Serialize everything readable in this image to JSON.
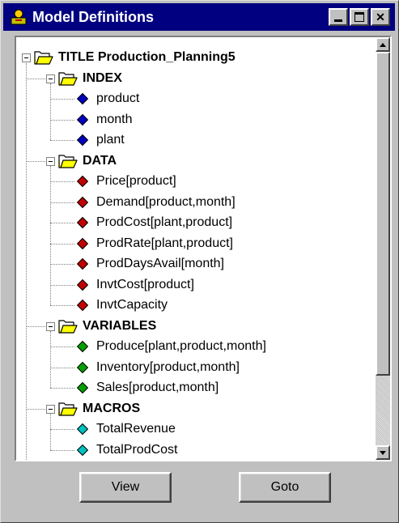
{
  "window": {
    "title": "Model Definitions",
    "close_glyph": "✕"
  },
  "colors": {
    "index": "#0000c0",
    "data": "#c00000",
    "variables": "#00a000",
    "macros": "#00c0c0",
    "folder": "#ffff00"
  },
  "tree": {
    "root": {
      "label": "TITLE Production_Planning5"
    },
    "groups": [
      {
        "key": "index",
        "label": "INDEX",
        "items": [
          "product",
          "month",
          "plant"
        ]
      },
      {
        "key": "data",
        "label": "DATA",
        "items": [
          "Price[product]",
          "Demand[product,month]",
          "ProdCost[plant,product]",
          "ProdRate[plant,product]",
          "ProdDaysAvail[month]",
          "InvtCost[product]",
          "InvtCapacity"
        ]
      },
      {
        "key": "variables",
        "label": "VARIABLES",
        "items": [
          "Produce[plant,product,month]",
          "Inventory[product,month]",
          "Sales[product,month]"
        ]
      },
      {
        "key": "macros",
        "label": "MACROS",
        "items": [
          "TotalRevenue",
          "TotalProdCost"
        ]
      }
    ]
  },
  "buttons": {
    "view": "View",
    "goto": "Goto"
  }
}
